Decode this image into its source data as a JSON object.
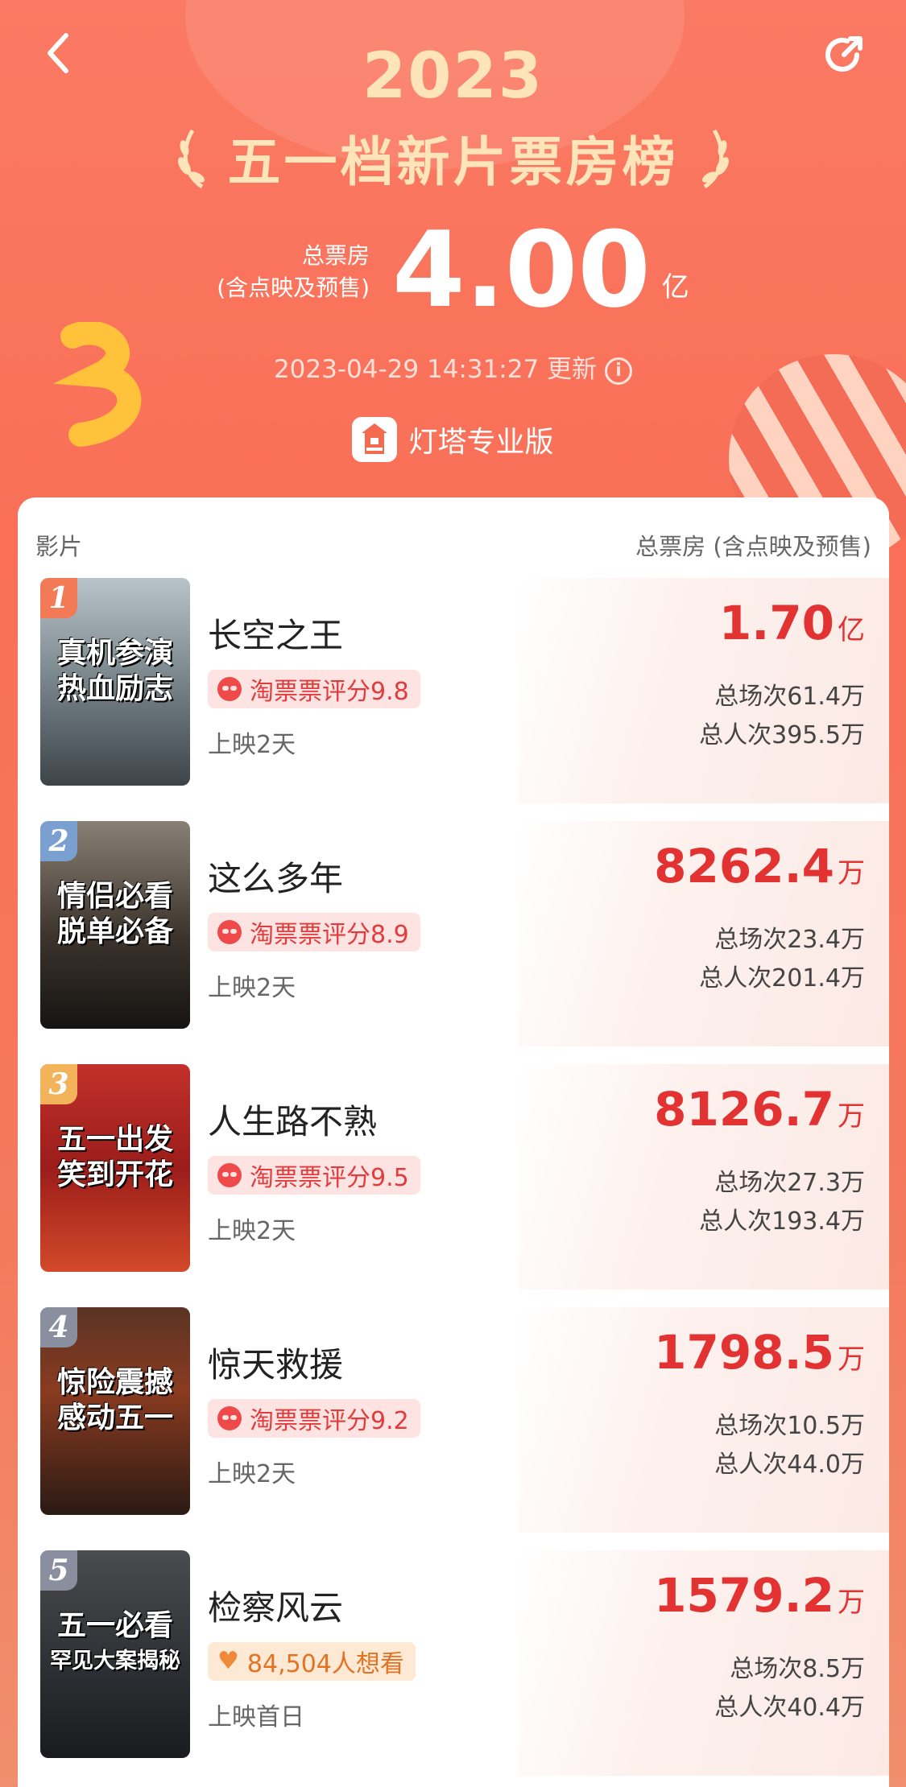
{
  "header": {
    "year": "2023",
    "title": "五一档新片票房榜",
    "total_label_line1": "总票房",
    "total_label_line2": "(含点映及预售)",
    "total_value": "4.00",
    "total_unit": "亿",
    "update_time": "2023-04-29 14:31:27 更新",
    "brand": "灯塔专业版"
  },
  "table": {
    "col_film": "影片",
    "col_gross": "总票房 (含点映及预售)"
  },
  "movies": [
    {
      "rank": "1",
      "name": "长空之王",
      "tag": "淘票票评分9.8",
      "days": "上映2天",
      "gross": "1.70",
      "gross_unit": "亿",
      "shows": "总场次61.4万",
      "viewers": "总人次395.5万",
      "poster_line1": "真机参演",
      "poster_line2": "热血励志",
      "badge_color": "#f27a57"
    },
    {
      "rank": "2",
      "name": "这么多年",
      "tag": "淘票票评分8.9",
      "days": "上映2天",
      "gross": "8262.4",
      "gross_unit": "万",
      "shows": "总场次23.4万",
      "viewers": "总人次201.4万",
      "poster_line1": "情侣必看",
      "poster_line2": "脱单必备",
      "badge_color": "#7aa0d2"
    },
    {
      "rank": "3",
      "name": "人生路不熟",
      "tag": "淘票票评分9.5",
      "days": "上映2天",
      "gross": "8126.7",
      "gross_unit": "万",
      "shows": "总场次27.3万",
      "viewers": "总人次193.4万",
      "poster_line1": "五一出发",
      "poster_line2": "笑到开花",
      "badge_color": "#f2b35a"
    },
    {
      "rank": "4",
      "name": "惊天救援",
      "tag": "淘票票评分9.2",
      "days": "上映2天",
      "gross": "1798.5",
      "gross_unit": "万",
      "shows": "总场次10.5万",
      "viewers": "总人次44.0万",
      "poster_line1": "惊险震撼",
      "poster_line2": "感动五一",
      "badge_color": "#8a8fa0"
    },
    {
      "rank": "5",
      "name": "检察风云",
      "tag": "84,504人想看",
      "days": "上映首日",
      "gross": "1579.2",
      "gross_unit": "万",
      "shows": "总场次8.5万",
      "viewers": "总人次40.4万",
      "poster_line1": "五一必看",
      "poster_line2": "罕见大案揭秘",
      "badge_color": "#8a8fa0"
    }
  ]
}
